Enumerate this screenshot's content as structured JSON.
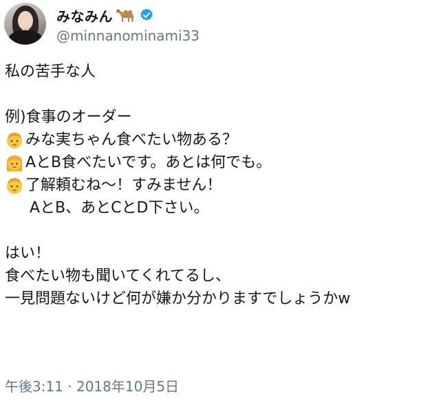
{
  "author": {
    "name": "みなみん",
    "handle": "@minnanominami33",
    "camel_icon": "camel-emoji",
    "verified_icon": "verified-badge"
  },
  "tweet": {
    "line1": "私の苦手な人",
    "line2": "例)食事のオーダー",
    "line3": "みな実ちゃん食べたい物ある？",
    "line4": "AとB食べたいです。あとは何でも。",
    "line5": "了解頼むね〜！すみません！",
    "line6": "AとB、あとCとD下さい。",
    "line7": "はい！",
    "line8": "食べたい物も聞いてくれてるし、",
    "line9": "一見問題ないけど何が嫌か分かりますでしょうかw",
    "emoji_man": "man-emoji",
    "emoji_woman": "woman-emoji"
  },
  "timestamp": "午後3:11 · 2018年10月5日",
  "colors": {
    "text": "#14171a",
    "secondary": "#657786",
    "verified": "#1da1f2"
  }
}
